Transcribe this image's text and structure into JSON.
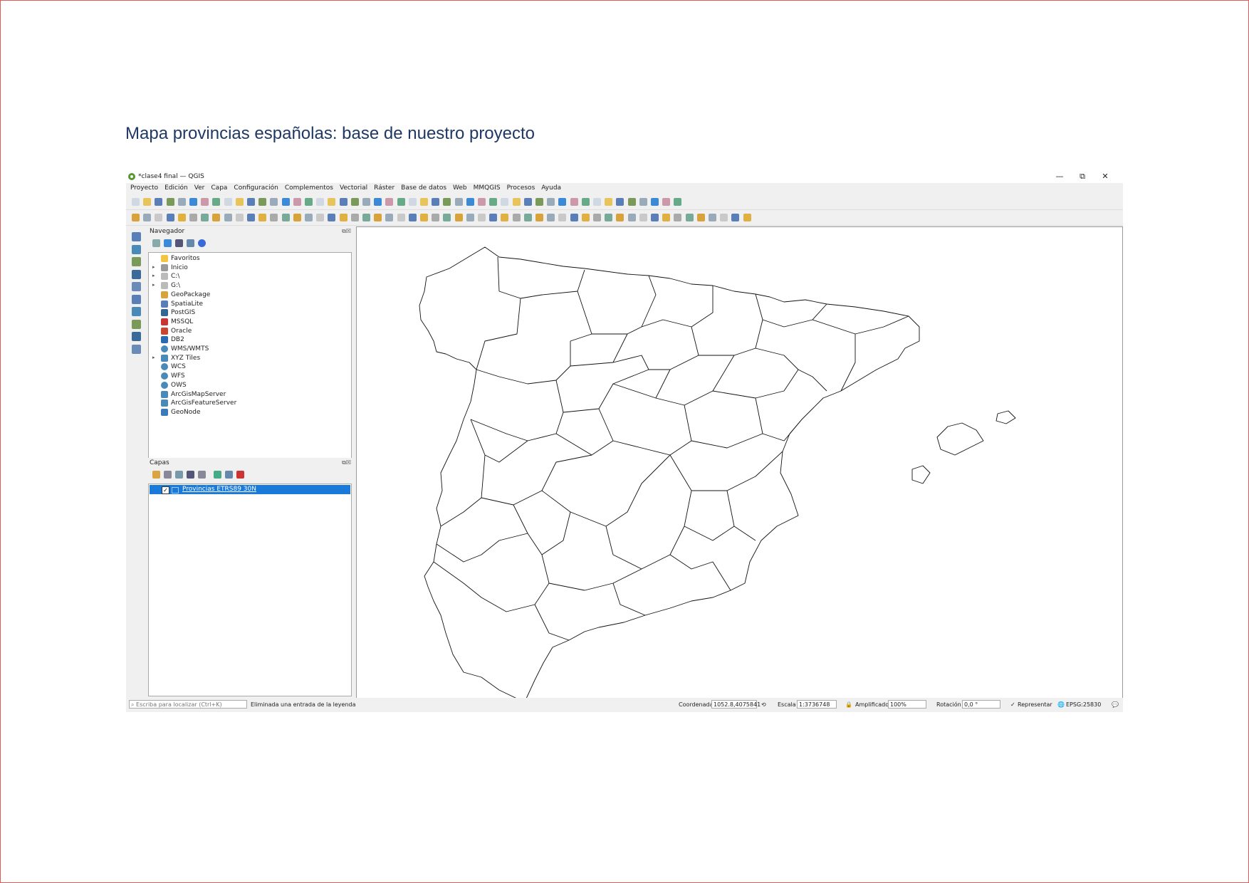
{
  "slide": {
    "title": "Mapa provincias españolas: base de nuestro proyecto"
  },
  "window": {
    "title": "*clase4 final — QGIS",
    "controls": {
      "minimize": "—",
      "restore": "⧉",
      "close": "✕"
    }
  },
  "menubar": {
    "items": [
      "Proyecto",
      "Edición",
      "Ver",
      "Capa",
      "Configuración",
      "Complementos",
      "Vectorial",
      "Ráster",
      "Base de datos",
      "Web",
      "MMQGIS",
      "Procesos",
      "Ayuda"
    ]
  },
  "browser_panel": {
    "title": "Navegador",
    "items": [
      {
        "label": "Favoritos",
        "icon": "star-icon",
        "arrow": ""
      },
      {
        "label": "Inicio",
        "icon": "home-folder-icon",
        "arrow": "▸"
      },
      {
        "label": "C:\\",
        "icon": "drive-icon",
        "arrow": "▸"
      },
      {
        "label": "G:\\",
        "icon": "drive-icon",
        "arrow": "▸"
      },
      {
        "label": "GeoPackage",
        "icon": "geopackage-icon",
        "arrow": ""
      },
      {
        "label": "SpatiaLite",
        "icon": "spatialite-icon",
        "arrow": ""
      },
      {
        "label": "PostGIS",
        "icon": "postgis-icon",
        "arrow": ""
      },
      {
        "label": "MSSQL",
        "icon": "mssql-icon",
        "arrow": ""
      },
      {
        "label": "Oracle",
        "icon": "oracle-icon",
        "arrow": ""
      },
      {
        "label": "DB2",
        "icon": "db2-icon",
        "arrow": ""
      },
      {
        "label": "WMS/WMTS",
        "icon": "globe-icon",
        "arrow": ""
      },
      {
        "label": "XYZ Tiles",
        "icon": "xyz-tiles-icon",
        "arrow": "▸"
      },
      {
        "label": "WCS",
        "icon": "globe-icon",
        "arrow": ""
      },
      {
        "label": "WFS",
        "icon": "globe-icon",
        "arrow": ""
      },
      {
        "label": "OWS",
        "icon": "globe-icon",
        "arrow": ""
      },
      {
        "label": "ArcGisMapServer",
        "icon": "arcgis-icon",
        "arrow": ""
      },
      {
        "label": "ArcGisFeatureServer",
        "icon": "arcgis-icon",
        "arrow": ""
      },
      {
        "label": "GeoNode",
        "icon": "geonode-icon",
        "arrow": ""
      }
    ]
  },
  "layers_panel": {
    "title": "Capas",
    "layers": [
      {
        "name": "Provincias ETRS89 30N",
        "checked": "✓"
      }
    ]
  },
  "statusbar": {
    "locator_placeholder": "Escriba para localizar (Ctrl+K)",
    "message": "Eliminada una entrada de la leyenda",
    "coordinate_label": "Coordenada",
    "coordinate_value": "1052.8,4075841",
    "scale_label": "Escala",
    "scale_value": "1:3736748",
    "magnifier_label": "Amplificador",
    "magnifier_value": "100%",
    "rotation_label": "Rotación",
    "rotation_value": "0,0 °",
    "render_label": "Representar",
    "render_checked": "✓",
    "crs": "EPSG:25830"
  },
  "colors": {
    "accent": "#1a7ad9",
    "qgis_green": "#589632",
    "slide_title": "#1f3864",
    "border": "#e05a5a"
  }
}
